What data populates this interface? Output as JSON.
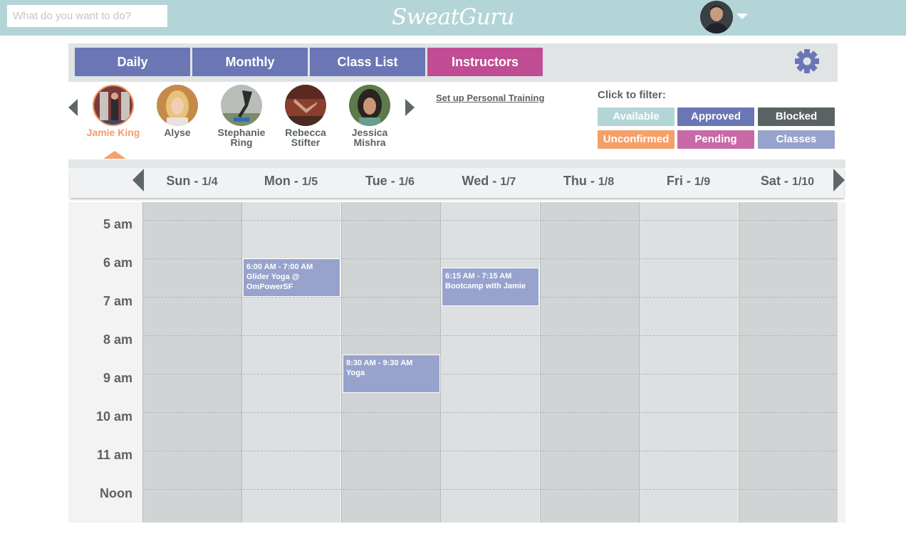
{
  "header": {
    "search_placeholder": "What do you want to do?",
    "logo": "SweatGuru"
  },
  "tabs": [
    {
      "label": "Daily",
      "color": "#6b76b4"
    },
    {
      "label": "Monthly",
      "color": "#6b76b4"
    },
    {
      "label": "Class List",
      "color": "#6b76b4"
    },
    {
      "label": "Instructors",
      "color": "#c04d93"
    }
  ],
  "instructors": [
    {
      "name": "Jamie King",
      "selected": true
    },
    {
      "name": "Alyse",
      "selected": false
    },
    {
      "name": "Stephanie\nRing",
      "selected": false
    },
    {
      "name": "Rebecca\nStifter",
      "selected": false
    },
    {
      "name": "Jessica\nMishra",
      "selected": false
    }
  ],
  "personal_training_link": "Set up Personal Training",
  "filters": {
    "title": "Click to filter:",
    "items": [
      {
        "label": "Available",
        "color": "#b4d5d7"
      },
      {
        "label": "Approved",
        "color": "#6b76b4"
      },
      {
        "label": "Blocked",
        "color": "#5b6263"
      },
      {
        "label": "Unconfirmed",
        "color": "#f5a06b"
      },
      {
        "label": "Pending",
        "color": "#c76aa6"
      },
      {
        "label": "Classes",
        "color": "#97a3cc"
      }
    ]
  },
  "days": [
    {
      "name": "Sun - ",
      "date": "1/4"
    },
    {
      "name": "Mon - ",
      "date": "1/5"
    },
    {
      "name": "Tue - ",
      "date": "1/6"
    },
    {
      "name": "Wed - ",
      "date": "1/7"
    },
    {
      "name": "Thu - ",
      "date": "1/8"
    },
    {
      "name": "Fri - ",
      "date": "1/9"
    },
    {
      "name": "Sat - ",
      "date": "1/10"
    }
  ],
  "hours": [
    "5 am",
    "6 am",
    "7 am",
    "8 am",
    "9 am",
    "10 am",
    "11 am",
    "Noon"
  ],
  "events": [
    {
      "time": "6:00 AM - 7:00 AM",
      "title": "Glider Yoga @ OmPowerSF"
    },
    {
      "time": "6:15 AM - 7:15 AM",
      "title": "Bootcamp with Jamie"
    },
    {
      "time": "8:30 AM - 9:30 AM",
      "title": "Yoga"
    }
  ]
}
